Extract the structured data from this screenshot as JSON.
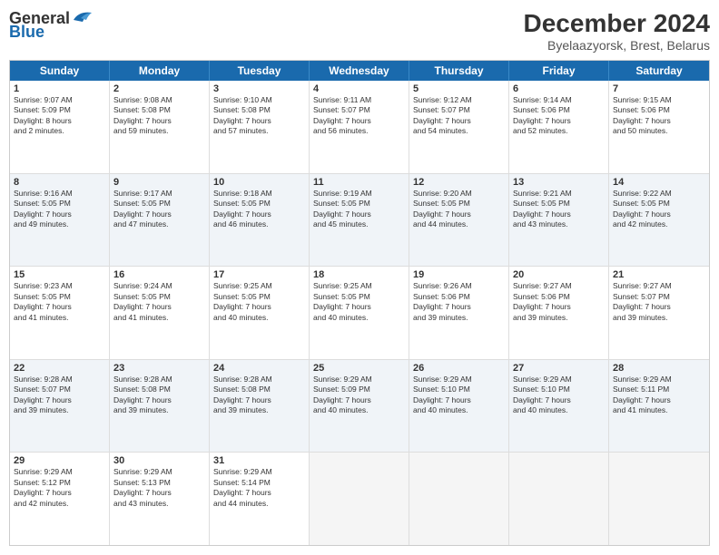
{
  "header": {
    "logo_general": "General",
    "logo_blue": "Blue",
    "month_title": "December 2024",
    "subtitle": "Byelaazyorsk, Brest, Belarus"
  },
  "days_of_week": [
    "Sunday",
    "Monday",
    "Tuesday",
    "Wednesday",
    "Thursday",
    "Friday",
    "Saturday"
  ],
  "weeks": [
    [
      {
        "day": "1",
        "lines": [
          "Sunrise: 9:07 AM",
          "Sunset: 5:09 PM",
          "Daylight: 8 hours",
          "and 2 minutes."
        ]
      },
      {
        "day": "2",
        "lines": [
          "Sunrise: 9:08 AM",
          "Sunset: 5:08 PM",
          "Daylight: 7 hours",
          "and 59 minutes."
        ]
      },
      {
        "day": "3",
        "lines": [
          "Sunrise: 9:10 AM",
          "Sunset: 5:08 PM",
          "Daylight: 7 hours",
          "and 57 minutes."
        ]
      },
      {
        "day": "4",
        "lines": [
          "Sunrise: 9:11 AM",
          "Sunset: 5:07 PM",
          "Daylight: 7 hours",
          "and 56 minutes."
        ]
      },
      {
        "day": "5",
        "lines": [
          "Sunrise: 9:12 AM",
          "Sunset: 5:07 PM",
          "Daylight: 7 hours",
          "and 54 minutes."
        ]
      },
      {
        "day": "6",
        "lines": [
          "Sunrise: 9:14 AM",
          "Sunset: 5:06 PM",
          "Daylight: 7 hours",
          "and 52 minutes."
        ]
      },
      {
        "day": "7",
        "lines": [
          "Sunrise: 9:15 AM",
          "Sunset: 5:06 PM",
          "Daylight: 7 hours",
          "and 50 minutes."
        ]
      }
    ],
    [
      {
        "day": "8",
        "lines": [
          "Sunrise: 9:16 AM",
          "Sunset: 5:05 PM",
          "Daylight: 7 hours",
          "and 49 minutes."
        ]
      },
      {
        "day": "9",
        "lines": [
          "Sunrise: 9:17 AM",
          "Sunset: 5:05 PM",
          "Daylight: 7 hours",
          "and 47 minutes."
        ]
      },
      {
        "day": "10",
        "lines": [
          "Sunrise: 9:18 AM",
          "Sunset: 5:05 PM",
          "Daylight: 7 hours",
          "and 46 minutes."
        ]
      },
      {
        "day": "11",
        "lines": [
          "Sunrise: 9:19 AM",
          "Sunset: 5:05 PM",
          "Daylight: 7 hours",
          "and 45 minutes."
        ]
      },
      {
        "day": "12",
        "lines": [
          "Sunrise: 9:20 AM",
          "Sunset: 5:05 PM",
          "Daylight: 7 hours",
          "and 44 minutes."
        ]
      },
      {
        "day": "13",
        "lines": [
          "Sunrise: 9:21 AM",
          "Sunset: 5:05 PM",
          "Daylight: 7 hours",
          "and 43 minutes."
        ]
      },
      {
        "day": "14",
        "lines": [
          "Sunrise: 9:22 AM",
          "Sunset: 5:05 PM",
          "Daylight: 7 hours",
          "and 42 minutes."
        ]
      }
    ],
    [
      {
        "day": "15",
        "lines": [
          "Sunrise: 9:23 AM",
          "Sunset: 5:05 PM",
          "Daylight: 7 hours",
          "and 41 minutes."
        ]
      },
      {
        "day": "16",
        "lines": [
          "Sunrise: 9:24 AM",
          "Sunset: 5:05 PM",
          "Daylight: 7 hours",
          "and 41 minutes."
        ]
      },
      {
        "day": "17",
        "lines": [
          "Sunrise: 9:25 AM",
          "Sunset: 5:05 PM",
          "Daylight: 7 hours",
          "and 40 minutes."
        ]
      },
      {
        "day": "18",
        "lines": [
          "Sunrise: 9:25 AM",
          "Sunset: 5:05 PM",
          "Daylight: 7 hours",
          "and 40 minutes."
        ]
      },
      {
        "day": "19",
        "lines": [
          "Sunrise: 9:26 AM",
          "Sunset: 5:06 PM",
          "Daylight: 7 hours",
          "and 39 minutes."
        ]
      },
      {
        "day": "20",
        "lines": [
          "Sunrise: 9:27 AM",
          "Sunset: 5:06 PM",
          "Daylight: 7 hours",
          "and 39 minutes."
        ]
      },
      {
        "day": "21",
        "lines": [
          "Sunrise: 9:27 AM",
          "Sunset: 5:07 PM",
          "Daylight: 7 hours",
          "and 39 minutes."
        ]
      }
    ],
    [
      {
        "day": "22",
        "lines": [
          "Sunrise: 9:28 AM",
          "Sunset: 5:07 PM",
          "Daylight: 7 hours",
          "and 39 minutes."
        ]
      },
      {
        "day": "23",
        "lines": [
          "Sunrise: 9:28 AM",
          "Sunset: 5:08 PM",
          "Daylight: 7 hours",
          "and 39 minutes."
        ]
      },
      {
        "day": "24",
        "lines": [
          "Sunrise: 9:28 AM",
          "Sunset: 5:08 PM",
          "Daylight: 7 hours",
          "and 39 minutes."
        ]
      },
      {
        "day": "25",
        "lines": [
          "Sunrise: 9:29 AM",
          "Sunset: 5:09 PM",
          "Daylight: 7 hours",
          "and 40 minutes."
        ]
      },
      {
        "day": "26",
        "lines": [
          "Sunrise: 9:29 AM",
          "Sunset: 5:10 PM",
          "Daylight: 7 hours",
          "and 40 minutes."
        ]
      },
      {
        "day": "27",
        "lines": [
          "Sunrise: 9:29 AM",
          "Sunset: 5:10 PM",
          "Daylight: 7 hours",
          "and 40 minutes."
        ]
      },
      {
        "day": "28",
        "lines": [
          "Sunrise: 9:29 AM",
          "Sunset: 5:11 PM",
          "Daylight: 7 hours",
          "and 41 minutes."
        ]
      }
    ],
    [
      {
        "day": "29",
        "lines": [
          "Sunrise: 9:29 AM",
          "Sunset: 5:12 PM",
          "Daylight: 7 hours",
          "and 42 minutes."
        ]
      },
      {
        "day": "30",
        "lines": [
          "Sunrise: 9:29 AM",
          "Sunset: 5:13 PM",
          "Daylight: 7 hours",
          "and 43 minutes."
        ]
      },
      {
        "day": "31",
        "lines": [
          "Sunrise: 9:29 AM",
          "Sunset: 5:14 PM",
          "Daylight: 7 hours",
          "and 44 minutes."
        ]
      },
      {
        "day": "",
        "lines": []
      },
      {
        "day": "",
        "lines": []
      },
      {
        "day": "",
        "lines": []
      },
      {
        "day": "",
        "lines": []
      }
    ]
  ],
  "alt_rows": [
    1,
    3
  ]
}
